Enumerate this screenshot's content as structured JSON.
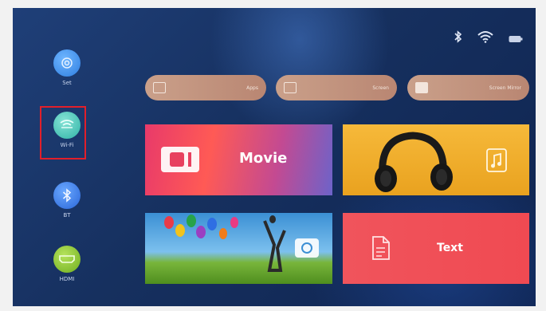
{
  "sidebar": {
    "items": [
      {
        "label": "Set",
        "icon": "settings-icon"
      },
      {
        "label": "Wi-Fi",
        "icon": "wifi-icon",
        "selected": true
      },
      {
        "label": "BT",
        "icon": "bluetooth-icon"
      },
      {
        "label": "HDMI",
        "icon": "hdmi-icon"
      }
    ]
  },
  "shortcuts": [
    {
      "label": "Apps",
      "icon": "calendar-icon"
    },
    {
      "label": "Screen",
      "icon": "window-icon"
    },
    {
      "label": "Screen Mirror",
      "icon": "mirror-icon"
    }
  ],
  "tiles": {
    "movie": {
      "label": "Movie"
    },
    "music": {
      "label": ""
    },
    "photo": {
      "label": ""
    },
    "text": {
      "label": "Text"
    }
  },
  "status_icons": [
    "bluetooth-icon",
    "wifi-signal-icon",
    "battery-icon"
  ],
  "colors": {
    "accent_selection": "#e11f2a",
    "background": "#16305f",
    "shortcut_pill": "#c49580",
    "movie_tile": "#e83a6a",
    "music_tile": "#f0ac2c",
    "text_tile": "#f04e56"
  }
}
